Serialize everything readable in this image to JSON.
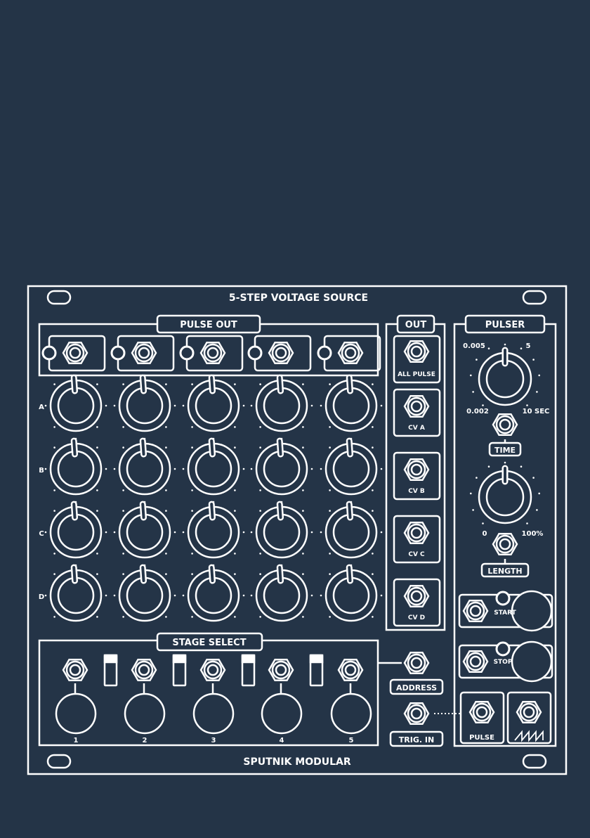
{
  "panel": {
    "title": "5-STEP VOLTAGE SOURCE",
    "brand": "SPUTNIK MODULAR",
    "background_color": "#243447",
    "line_color": "#ffffff"
  },
  "pulse_out": {
    "title": "PULSE OUT"
  },
  "knob_grid": {
    "rows": [
      "A",
      "B",
      "C",
      "D"
    ]
  },
  "stage_select": {
    "title": "STAGE SELECT",
    "stages": [
      "1",
      "2",
      "3",
      "4",
      "5"
    ]
  },
  "out": {
    "title": "OUT",
    "jacks": [
      "ALL PULSE",
      "CV A",
      "CV B",
      "CV C",
      "CV D"
    ]
  },
  "address_label": "ADDRESS",
  "trig_in_label": "TRIG. IN",
  "pulser": {
    "title": "PULSER",
    "time": {
      "min_a": "0.005",
      "max_a": "5",
      "min_b": "0.002",
      "max_b": "10 SEC",
      "label": "TIME"
    },
    "length": {
      "min": "0",
      "max": "100%",
      "label": "LENGTH"
    },
    "start_label": "START",
    "stop_label": "STOP",
    "pulse_label": "PULSE",
    "sawtooth_icon": "sawtooth-icon"
  }
}
